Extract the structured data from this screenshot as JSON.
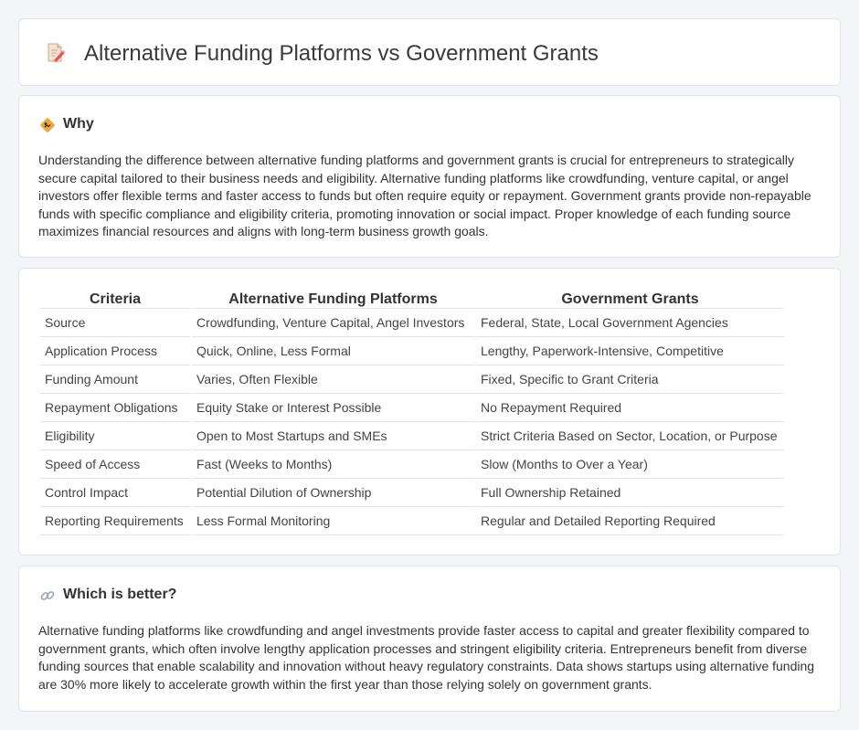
{
  "header": {
    "title": "Alternative Funding Platforms vs Government Grants",
    "icon": "document-pencil-icon"
  },
  "why": {
    "title": "Why",
    "icon": "diamond-sign-icon",
    "body": "Understanding the difference between alternative funding platforms and government grants is crucial for entrepreneurs to strategically secure capital tailored to their business needs and eligibility. Alternative funding platforms like crowdfunding, venture capital, or angel investors offer flexible terms and faster access to funds but often require equity or repayment. Government grants provide non-repayable funds with specific compliance and eligibility criteria, promoting innovation or social impact. Proper knowledge of each funding source maximizes financial resources and aligns with long-term business growth goals."
  },
  "table": {
    "headers": [
      "Criteria",
      "Alternative Funding Platforms",
      "Government Grants"
    ],
    "rows": [
      [
        "Source",
        "Crowdfunding, Venture Capital, Angel Investors",
        "Federal, State, Local Government Agencies"
      ],
      [
        "Application Process",
        "Quick, Online, Less Formal",
        "Lengthy, Paperwork-Intensive, Competitive"
      ],
      [
        "Funding Amount",
        "Varies, Often Flexible",
        "Fixed, Specific to Grant Criteria"
      ],
      [
        "Repayment Obligations",
        "Equity Stake or Interest Possible",
        "No Repayment Required"
      ],
      [
        "Eligibility",
        "Open to Most Startups and SMEs",
        "Strict Criteria Based on Sector, Location, or Purpose"
      ],
      [
        "Speed of Access",
        "Fast (Weeks to Months)",
        "Slow (Months to Over a Year)"
      ],
      [
        "Control Impact",
        "Potential Dilution of Ownership",
        "Full Ownership Retained"
      ],
      [
        "Reporting Requirements",
        "Less Formal Monitoring",
        "Regular and Detailed Reporting Required"
      ]
    ]
  },
  "better": {
    "title": "Which is better?",
    "icon": "link-icon",
    "body": "Alternative funding platforms like crowdfunding and angel investments provide faster access to capital and greater flexibility compared to government grants, which often involve lengthy application processes and stringent eligibility criteria. Entrepreneurs benefit from diverse funding sources that enable scalability and innovation without heavy regulatory constraints. Data shows startups using alternative funding are 30% more likely to accelerate growth within the first year than those relying solely on government grants."
  }
}
